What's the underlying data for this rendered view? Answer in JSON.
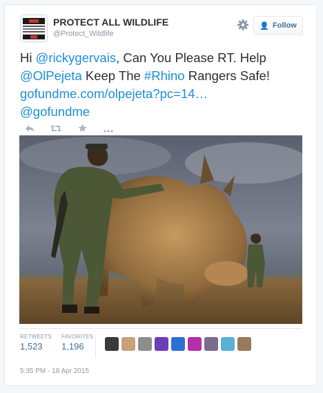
{
  "account": {
    "display_name": "PROTECT ALL WILDLIFE",
    "handle": "@Protect_Wildlife",
    "avatar_icon": "organization-logo-icon"
  },
  "header": {
    "follow_label": "Follow",
    "settings_icon": "gear-icon"
  },
  "tweet": {
    "part1": "Hi ",
    "mention1": "@rickygervais",
    "part2": ", Can You Please RT. Help ",
    "mention2": "@OlPejeta",
    "part3": " Keep The ",
    "hashtag": "#Rhino",
    "part4": " Rangers Safe! ",
    "url": "gofundme.com/olpejeta?pc=14…",
    "mention3": "@gofundme"
  },
  "actions": [
    "reply-icon",
    "retweet-icon",
    "favorite-icon",
    "more-icon"
  ],
  "photo": {
    "subject": "rhino-with-rangers"
  },
  "stats": {
    "retweets_label": "RETWEETS",
    "retweets_value": "1,523",
    "favorites_label": "FAVORITES",
    "favorites_value": "1,196"
  },
  "favoriters": [
    "#3a3a3a",
    "#c9a07a",
    "#8e8e8e",
    "#6a3fb5",
    "#2e6fd6",
    "#b52fa8",
    "#7c6a8f",
    "#5ab0d8",
    "#9b7a5c"
  ],
  "timestamp": "5:35 PM - 18 Apr 2015",
  "colors": {
    "link": "#1b8fd6",
    "stat_value": "#3d6f9a",
    "muted": "#8899a6"
  }
}
